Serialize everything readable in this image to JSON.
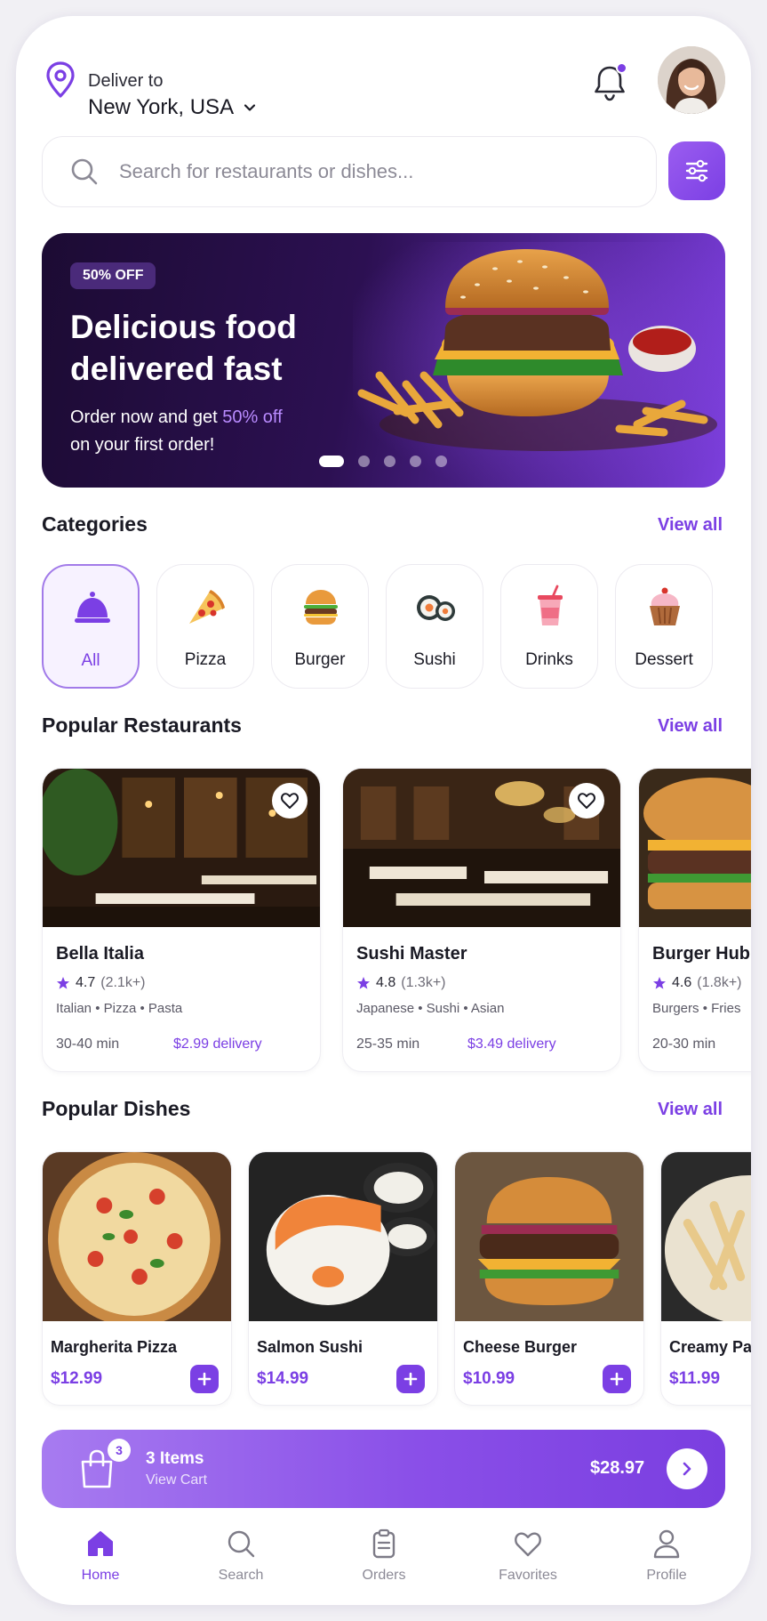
{
  "header": {
    "deliver_label": "Deliver to",
    "location": "New York, USA",
    "notification_dot": true
  },
  "search": {
    "placeholder": "Search for restaurants or dishes..."
  },
  "promo": {
    "badge": "50% OFF",
    "title": "Delicious food delivered fast",
    "subtitle_prefix": "Order now and get ",
    "subtitle_highlight": "50% off",
    "subtitle_suffix": "on your first order!",
    "slide_count": 5,
    "active_slide": 1
  },
  "categories": {
    "title": "Categories",
    "view_all": "View all",
    "items": [
      {
        "label": "All",
        "icon": "cloche-icon",
        "active": true
      },
      {
        "label": "Pizza",
        "icon": "pizza-icon",
        "active": false
      },
      {
        "label": "Burger",
        "icon": "burger-icon",
        "active": false
      },
      {
        "label": "Sushi",
        "icon": "sushi-icon",
        "active": false
      },
      {
        "label": "Drinks",
        "icon": "drink-icon",
        "active": false
      },
      {
        "label": "Dessert",
        "icon": "cupcake-icon",
        "active": false
      }
    ]
  },
  "restaurants": {
    "title": "Popular Restaurants",
    "view_all": "View all",
    "items": [
      {
        "name": "Bella Italia",
        "rating": "4.7",
        "reviews": "(2.1k+)",
        "tags": "Italian • Pizza • Pasta",
        "time": "30-40 min",
        "delivery": "$2.99 delivery"
      },
      {
        "name": "Sushi Master",
        "rating": "4.8",
        "reviews": "(1.3k+)",
        "tags": "Japanese • Sushi • Asian",
        "time": "25-35 min",
        "delivery": "$3.49 delivery"
      },
      {
        "name": "Burger Hub",
        "rating": "4.6",
        "reviews": "(1.8k+)",
        "tags": "Burgers • Fries",
        "time": "20-30 min",
        "delivery": ""
      }
    ]
  },
  "dishes": {
    "title": "Popular Dishes",
    "view_all": "View all",
    "items": [
      {
        "name": "Margherita Pizza",
        "price": "$12.99"
      },
      {
        "name": "Salmon Sushi",
        "price": "$14.99"
      },
      {
        "name": "Cheese Burger",
        "price": "$10.99"
      },
      {
        "name": "Creamy Pa",
        "price": "$11.99"
      }
    ]
  },
  "cart": {
    "count": "3",
    "items_label": "3 Items",
    "view_label": "View Cart",
    "total": "$28.97"
  },
  "nav": {
    "items": [
      {
        "label": "Home",
        "icon": "home-icon",
        "active": true
      },
      {
        "label": "Search",
        "icon": "search-icon",
        "active": false
      },
      {
        "label": "Orders",
        "icon": "orders-icon",
        "active": false
      },
      {
        "label": "Favorites",
        "icon": "heart-icon",
        "active": false
      },
      {
        "label": "Profile",
        "icon": "profile-icon",
        "active": false
      }
    ]
  },
  "colors": {
    "accent": "#7b3fe4",
    "accent_light": "#b98bff",
    "hero_dark": "#1c0b33",
    "text_primary": "#1a1a24",
    "text_secondary": "#8c8a96"
  }
}
